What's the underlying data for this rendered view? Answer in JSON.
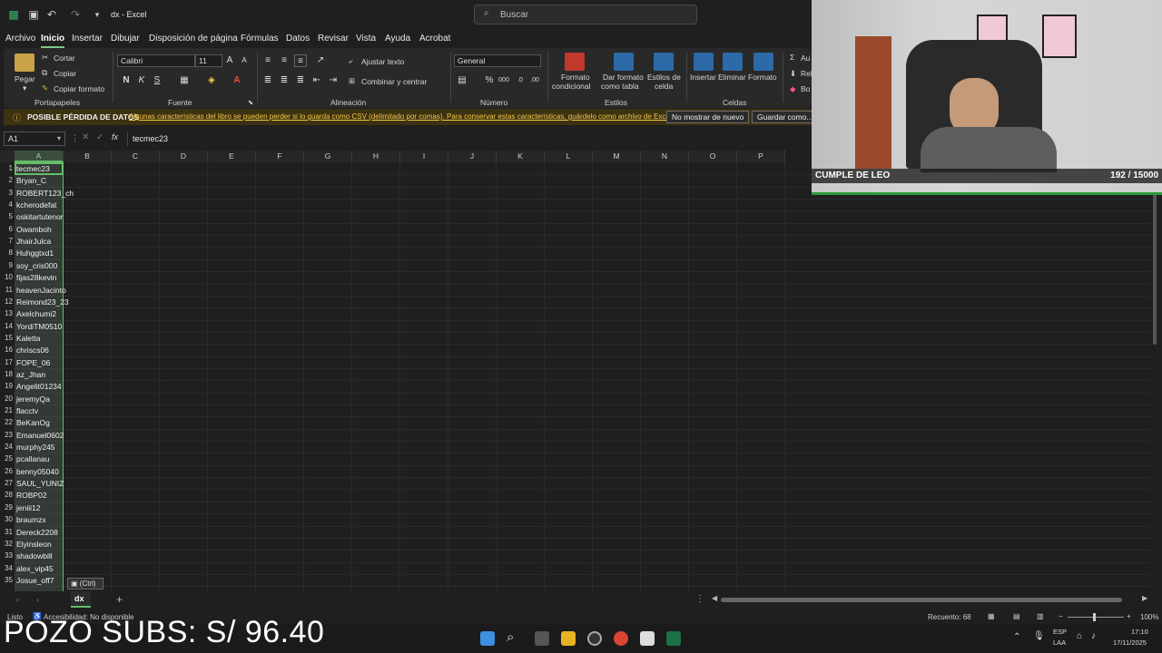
{
  "titlebar": {
    "doc_title": "dx - Excel",
    "search_placeholder": "Buscar"
  },
  "menu": [
    "Archivo",
    "Inicio",
    "Insertar",
    "Dibujar",
    "Disposición de página",
    "Fórmulas",
    "Datos",
    "Revisar",
    "Vista",
    "Ayuda",
    "Acrobat"
  ],
  "ribbon": {
    "paste": "Pegar",
    "cut": "Cortar",
    "copy": "Copiar",
    "format_painter": "Copiar formato",
    "clipboard_group": "Portapapeles",
    "font_name": "Calibri",
    "font_size": "11",
    "font_group": "Fuente",
    "wrap_text": "Ajustar texto",
    "merge_center": "Combinar y centrar",
    "align_group": "Alineación",
    "number_format": "General",
    "number_group": "Número",
    "cond_format_1": "Formato",
    "cond_format_2": "condicional",
    "table_format_1": "Dar formato",
    "table_format_2": "como tabla",
    "cell_styles_1": "Estilos de",
    "cell_styles_2": "celda",
    "styles_group": "Estilos",
    "insert": "Insertar",
    "delete": "Eliminar",
    "format": "Formato",
    "cells_group": "Celdas",
    "autosum": "Au",
    "fill": "Rel",
    "clear": "Bo",
    "bold": "N",
    "italic": "K",
    "underline": "S"
  },
  "warning": {
    "title": "POSIBLE PÉRDIDA DE DATOS",
    "message": "Algunas características del libro se pueden perder si lo guarda como CSV (delimitado por comas). Para conservar estas características, guárdelo como archivo de Excel.",
    "dont_show": "No mostrar de nuevo",
    "save_as": "Guardar como..."
  },
  "formula_bar": {
    "name_box": "A1",
    "fx": "fx",
    "content": "tecmec23"
  },
  "columns": [
    "A",
    "B",
    "C",
    "D",
    "E",
    "F",
    "G",
    "H",
    "I",
    "J",
    "K",
    "L",
    "M",
    "N",
    "O",
    "P"
  ],
  "rows": [
    {
      "n": "1",
      "a": "tecmec23"
    },
    {
      "n": "2",
      "a": "Bryan_C"
    },
    {
      "n": "3",
      "a": "ROBERT123_ch"
    },
    {
      "n": "4",
      "a": "kcherodefat"
    },
    {
      "n": "5",
      "a": "oskitartutenor"
    },
    {
      "n": "6",
      "a": "Owamboh"
    },
    {
      "n": "7",
      "a": "JhairJulca"
    },
    {
      "n": "8",
      "a": "Huhggtxd1"
    },
    {
      "n": "9",
      "a": "soy_cris000"
    },
    {
      "n": "10",
      "a": "fijas28kevin"
    },
    {
      "n": "11",
      "a": "heavenJacinto"
    },
    {
      "n": "12",
      "a": "Reimond23_23"
    },
    {
      "n": "13",
      "a": "Axelchumi2"
    },
    {
      "n": "14",
      "a": "YordiTM0510"
    },
    {
      "n": "15",
      "a": "Kaletta"
    },
    {
      "n": "16",
      "a": "chriscs06"
    },
    {
      "n": "17",
      "a": "FOPE_06"
    },
    {
      "n": "18",
      "a": "az_Jhan"
    },
    {
      "n": "19",
      "a": "Angelit01234"
    },
    {
      "n": "20",
      "a": "jeremyQa"
    },
    {
      "n": "21",
      "a": "flacctv"
    },
    {
      "n": "22",
      "a": "BeKanOg"
    },
    {
      "n": "23",
      "a": "Emanuel0602"
    },
    {
      "n": "24",
      "a": "murphy245"
    },
    {
      "n": "25",
      "a": "pcallanau"
    },
    {
      "n": "26",
      "a": "benny05040"
    },
    {
      "n": "27",
      "a": "SAUL_YUNIZ"
    },
    {
      "n": "28",
      "a": "ROBP02"
    },
    {
      "n": "29",
      "a": "jeniii12"
    },
    {
      "n": "30",
      "a": "braumzx"
    },
    {
      "n": "31",
      "a": "Dereck2208"
    },
    {
      "n": "32",
      "a": "Elyinsleon"
    },
    {
      "n": "33",
      "a": "shadowbill"
    },
    {
      "n": "34",
      "a": "alex_vip45"
    },
    {
      "n": "35",
      "a": "Josue_off7"
    }
  ],
  "paste_tag": "(Ctrl)",
  "sheet_tab": "dx",
  "status": {
    "ready": "Listo",
    "accessibility": "Accesibilidad: No disponible",
    "count": "Recuento: 68",
    "zoom": "100%"
  },
  "taskbar": {
    "lang1": "ESP",
    "lang2": "LAA",
    "time": "17:10",
    "date": "17/11/2025"
  },
  "webcam": {
    "banner_title": "CUMPLE DE LEO",
    "banner_count": "192 / 15000"
  },
  "overlay_text": "POZO SUBS: S/ 96.40"
}
